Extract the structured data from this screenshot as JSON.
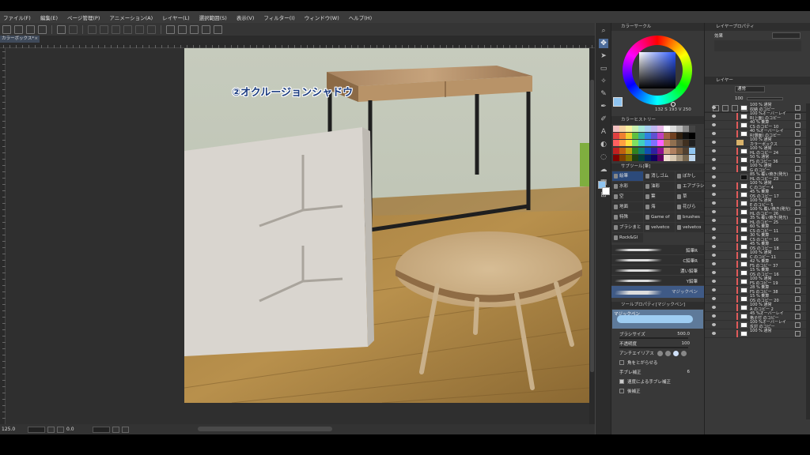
{
  "menu": [
    "ファイル(F)",
    "編集(E)",
    "ページ管理(P)",
    "アニメーション(A)",
    "レイヤー(L)",
    "選択範囲(S)",
    "表示(V)",
    "フィルター(I)",
    "ウィンドウ(W)",
    "ヘルプ(H)"
  ],
  "document_tab": {
    "title": "カラーボックス*",
    "close": "×"
  },
  "canvas_annotation": "②オクルージョンシャドウ",
  "status": {
    "zoom": "125.0",
    "angle": "0.0"
  },
  "color_panel": {
    "title": "カラーサークル",
    "hsv": "132 S 193 V 250",
    "fg_color": "#8fc4f0"
  },
  "color_history_title": "カラーヒストリー",
  "subtool": {
    "title": "サブツール[筆]",
    "items": [
      "絵筆",
      "消しゴム",
      "ぼかし",
      "水彩",
      "油彩",
      "エアブラシ",
      "空",
      "葉",
      "草",
      "地面",
      "海",
      "花びら",
      "特殊",
      "Game of",
      "brushes",
      "ブラシまと",
      "velvetco",
      "velvetco",
      "Rock&Gl"
    ],
    "active_index": 0,
    "brushes": [
      "鉛筆R",
      "C鉛筆R",
      "濃い鉛筆",
      "Y鉛筆",
      "マジックペン"
    ],
    "active_brush": "マジックペン"
  },
  "tool_property": {
    "title": "ツールプロパティ[マジックペン]",
    "preview_name": "マジックペン",
    "brush_size_label": "ブラシサイズ",
    "brush_size": "500.0",
    "opacity_label": "不透明度",
    "opacity": "100",
    "antialias_label": "アンチエイリアス",
    "sharpen_label": "角をとがらせる",
    "stabilize_label": "手ブレ補正",
    "stabilize": "6",
    "speed_label": "速度による手ブレ補正",
    "post_label": "後補正"
  },
  "layer_property": {
    "title": "レイヤープロパティ",
    "effect_label": "効果"
  },
  "layer_panel": {
    "title": "レイヤー",
    "blend_mode": "通常",
    "opacity": "100"
  },
  "layers": [
    {
      "name": "100 % 通常\n収納 のコピー",
      "thumb": "white",
      "red": false,
      "sel": false
    },
    {
      "name": "100 %オーバーレイ\nR(上面) のコピー",
      "thumb": "white",
      "red": true,
      "sel": false
    },
    {
      "name": "40 % 乗算\nCS のコピー 10",
      "thumb": "white",
      "red": true,
      "sel": false
    },
    {
      "name": "40 %オーバーレイ\nR(側面) のコピー",
      "thumb": "white",
      "red": true,
      "sel": false
    },
    {
      "name": "100 % 通常\nカラーボックス",
      "thumb": "folder",
      "red": false,
      "sel": false
    },
    {
      "name": "100 % 通常\nHL のコピー 24",
      "thumb": "white",
      "red": true,
      "sel": false
    },
    {
      "name": "50 % 通常\nFS のコピー 36",
      "thumb": "white",
      "red": true,
      "sel": false
    },
    {
      "name": "100 % 通常\nG のコピー",
      "thumb": "white",
      "red": true,
      "sel": false
    },
    {
      "name": "85 % 覆い焼き(発光)\nHL のコピー 23",
      "thumb": "dark",
      "red": false,
      "sel": false
    },
    {
      "name": "100 % 通常\nC のコピー 4",
      "thumb": "white",
      "red": true,
      "sel": false
    },
    {
      "name": "45 % 乗算\nOS のコピー 17",
      "thumb": "white",
      "red": true,
      "sel": false
    },
    {
      "name": "100 % 通常\nE のコピー 5",
      "thumb": "white",
      "red": true,
      "sel": false
    },
    {
      "name": "100 % 覆い焼き(発光)\nHL のコピー 26",
      "thumb": "white",
      "red": true,
      "sel": false
    },
    {
      "name": "35 % 覆い焼き(発光)\nHL のコピー 25",
      "thumb": "white",
      "red": true,
      "sel": false
    },
    {
      "name": "60 % 乗算\nCS のコピー 11",
      "thumb": "white",
      "red": true,
      "sel": false
    },
    {
      "name": "30 % 乗算\nCS のコピー 16",
      "thumb": "white",
      "red": true,
      "sel": false
    },
    {
      "name": "45 % 乗算\nOS のコピー 18",
      "thumb": "white",
      "red": true,
      "sel": false
    },
    {
      "name": "100 % 通常\nC のコピー 11",
      "thumb": "white",
      "red": true,
      "sel": false
    },
    {
      "name": "42 % 乗算\nFS のコピー 37",
      "thumb": "white",
      "red": true,
      "sel": false
    },
    {
      "name": "15 % 乗算\nOS のコピー 16",
      "thumb": "white",
      "red": true,
      "sel": false
    },
    {
      "name": "100 % 通常\nFS のコピー 19",
      "thumb": "white",
      "red": true,
      "sel": false
    },
    {
      "name": "28 % 乗算\nFS のコピー 38",
      "thumb": "white",
      "red": true,
      "sel": false
    },
    {
      "name": "15 % 乗算\nOS のコピー 20",
      "thumb": "white",
      "red": true,
      "sel": false
    },
    {
      "name": "100 % 通常\nA のコピー 2",
      "thumb": "white",
      "red": true,
      "sel": false
    },
    {
      "name": "45 %オーバーレイ\n格子付 のコピー",
      "thumb": "white",
      "red": true,
      "sel": false
    },
    {
      "name": "100 %オーバーレイ\n反対 のコピー",
      "thumb": "white",
      "red": true,
      "sel": false
    },
    {
      "name": "100 % 通常\n",
      "thumb": "white",
      "red": true,
      "sel": false
    }
  ],
  "colors": {
    "accent": "#46648f",
    "active_tool": "#4d6c9a",
    "mark_red": "#e05a5a"
  }
}
